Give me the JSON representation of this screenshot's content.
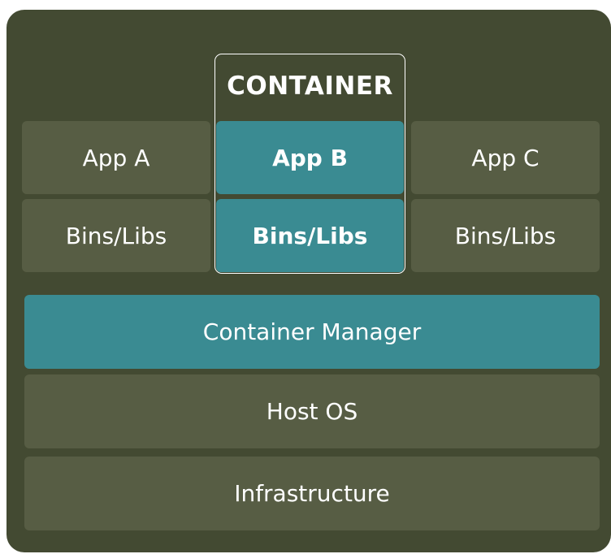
{
  "diagram": {
    "container_label": "CONTAINER",
    "apps": [
      {
        "app": "App A",
        "libs": "Bins/Libs"
      },
      {
        "app": "App B",
        "libs": "Bins/Libs"
      },
      {
        "app": "App C",
        "libs": "Bins/Libs"
      }
    ],
    "layers": {
      "container_manager": "Container Manager",
      "host_os": "Host OS",
      "infrastructure": "Infrastructure"
    },
    "colors": {
      "background": "#434a32",
      "block": "#575d44",
      "highlight": "#3a8b92",
      "text": "#ffffff"
    }
  }
}
